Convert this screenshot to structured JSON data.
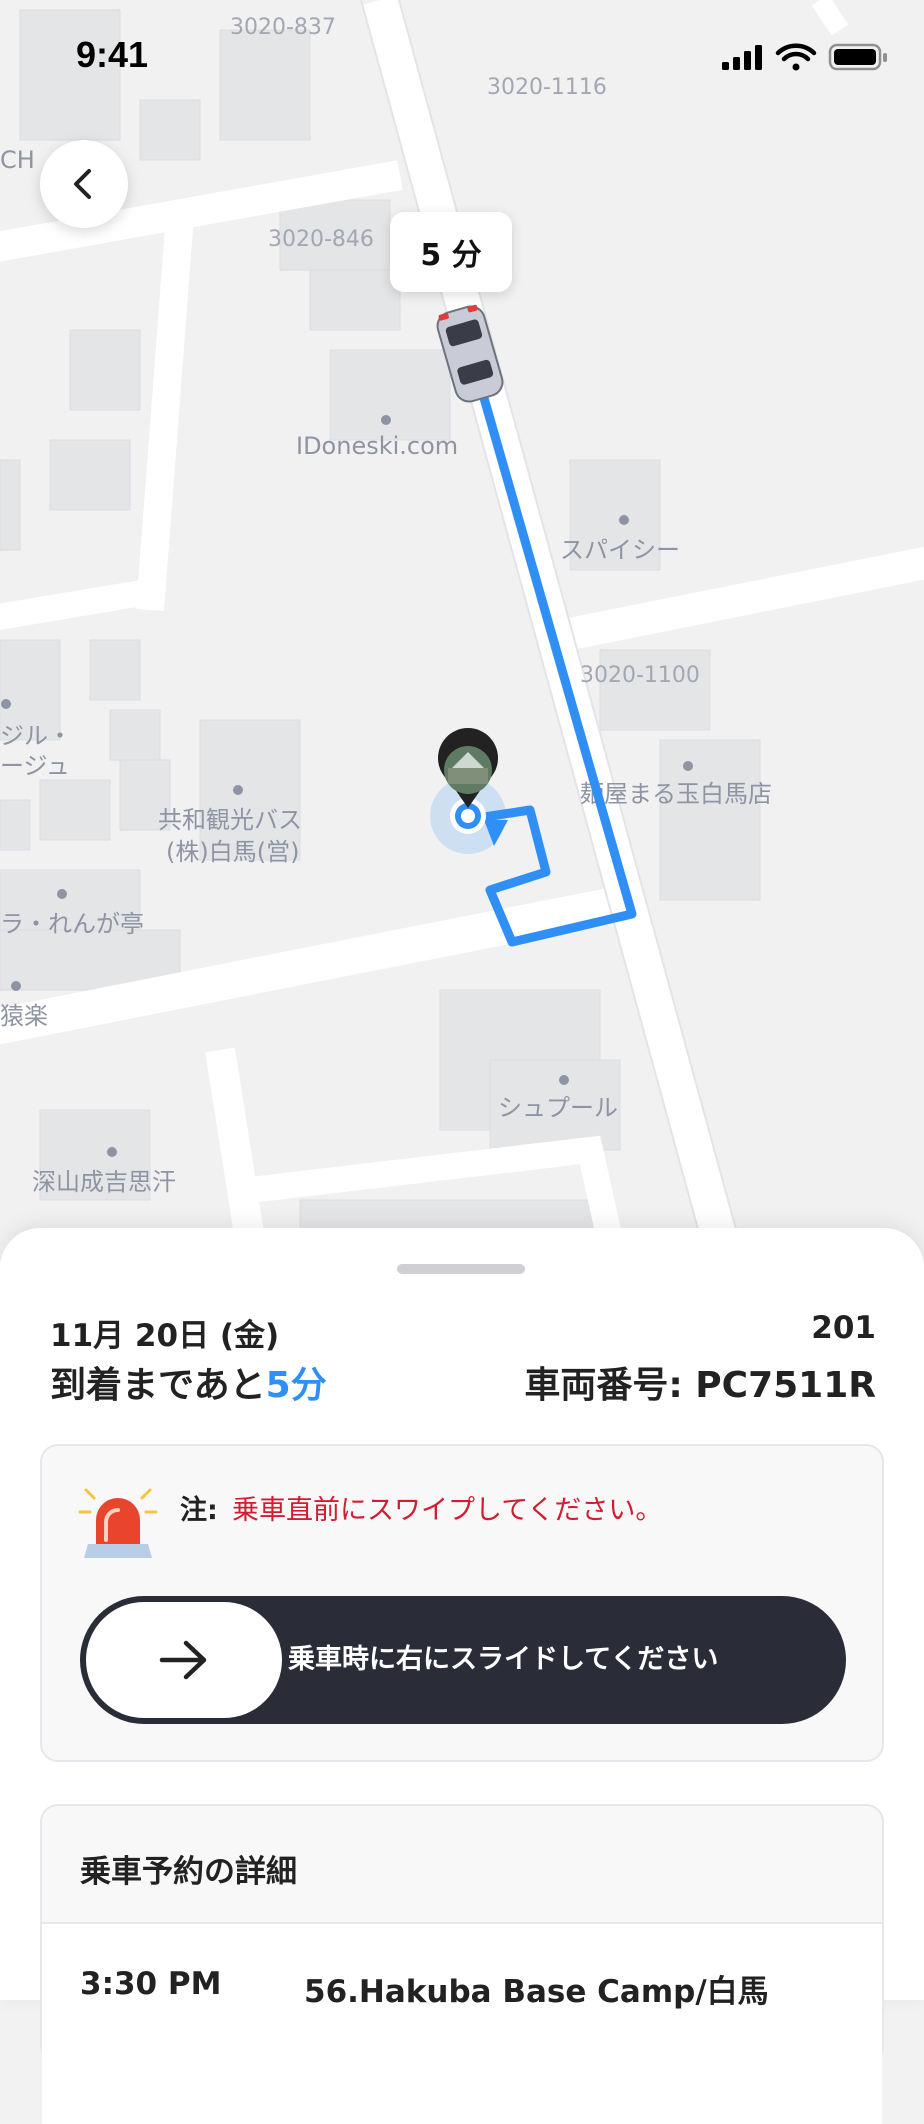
{
  "status_bar": {
    "time": "9:41"
  },
  "map": {
    "eta_bubble": "5 分",
    "addresses": [
      "3020-837",
      "3020-1116",
      "3020-846",
      "3020-1100"
    ],
    "places": {
      "idoneski": "IDoneski.com",
      "spicy": "スパイシー",
      "menya": "麺屋まる玉白馬店",
      "kyowa_1": "共和観光バス",
      "kyowa_2": "(株)白馬(営)",
      "shupool": "シュプール",
      "fukayama": "深山成吉思汗",
      "gil_1": "ジル・",
      "gil_2": "ージュ",
      "renga": "ラ・れんが亭",
      "enraku": "猿楽",
      "partial_ch": "CH"
    }
  },
  "sheet": {
    "date": "11月 20日 (金)",
    "number": "201",
    "eta_prefix": "到着まであと",
    "eta_value": "5分",
    "vehicle": "車両番号: PC7511R",
    "note_label": "注:",
    "note_text": "乗車直前にスワイプしてください。",
    "slider_label": "乗車時に右にスライドしてください",
    "details_title": "乗車予約の詳細",
    "detail_time": "3:30 PM",
    "detail_place": "56.Hakuba Base Camp/白馬"
  },
  "colors": {
    "route": "#2f8ff5",
    "accent": "#2f8ff5",
    "warning": "#d11d33",
    "slider_bg": "#2a2d38"
  },
  "icons": [
    "back-chevron-icon",
    "car-icon",
    "pickup-pin-icon",
    "user-location-icon",
    "siren-icon",
    "arrow-right-icon",
    "signal-icon",
    "wifi-icon",
    "battery-icon"
  ]
}
